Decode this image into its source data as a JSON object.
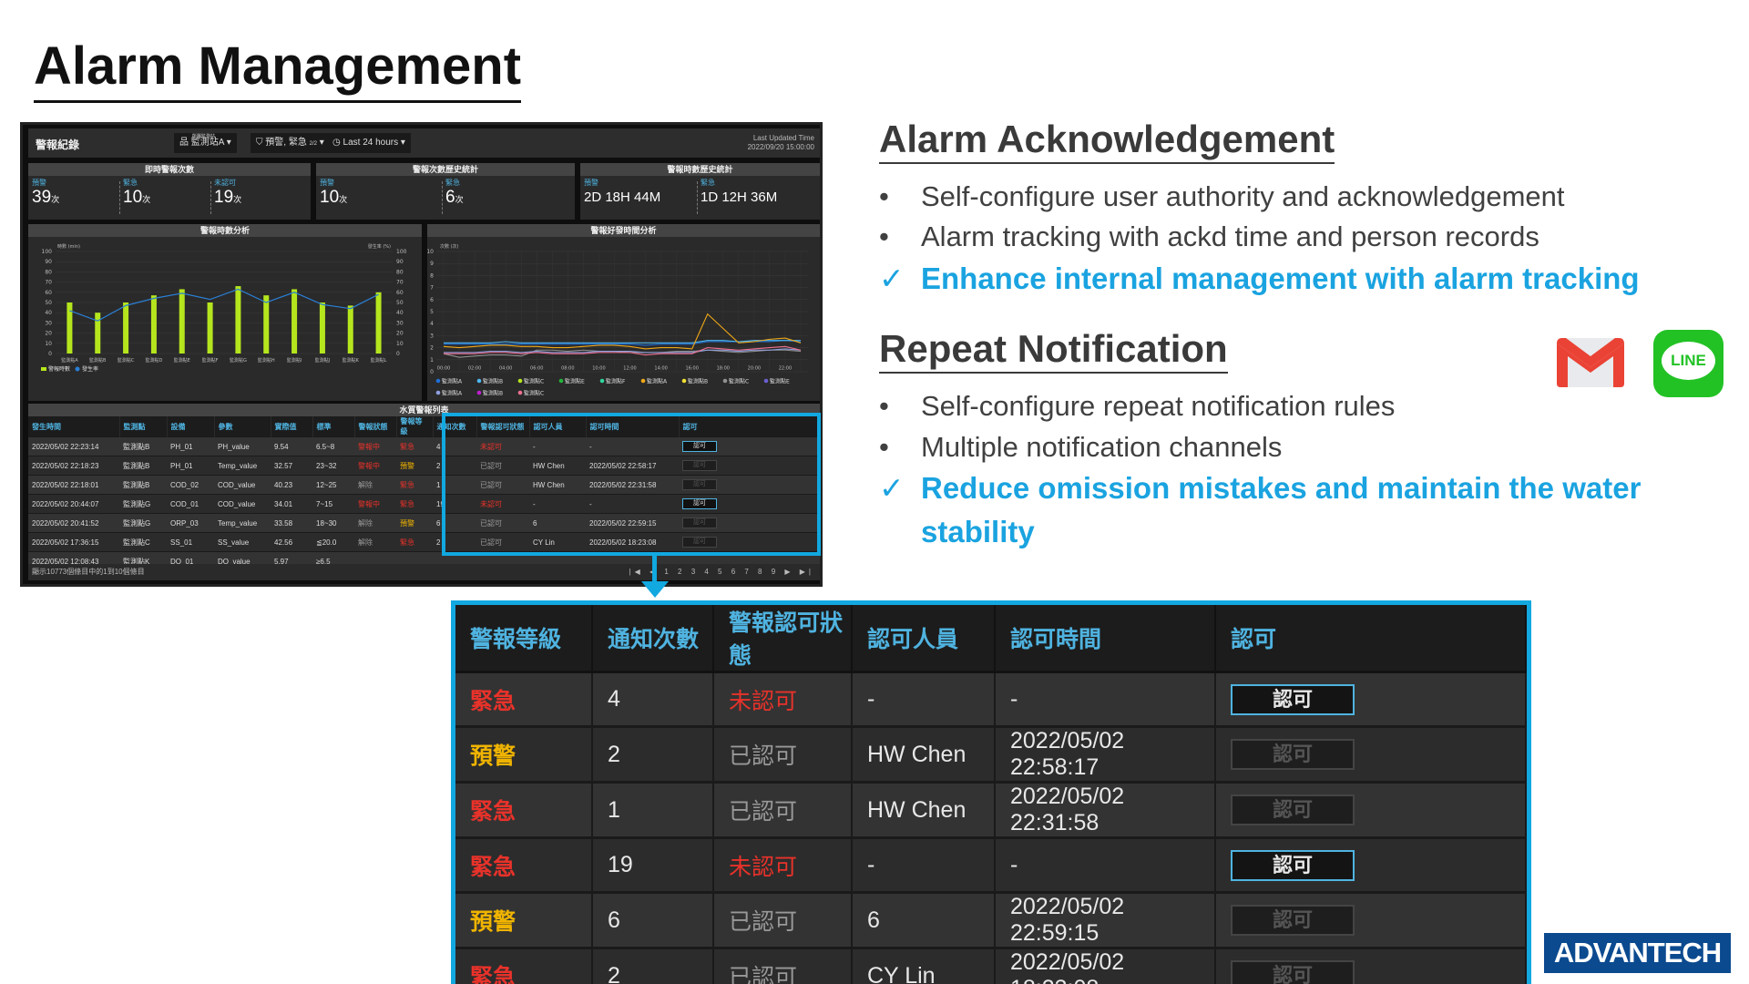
{
  "title": "Alarm Management",
  "dashboard": {
    "header": {
      "title": "警報紀錄",
      "site_label": "所屬監測站",
      "site": "監測站A",
      "filter": "預警, 緊急",
      "filter_count": "2/2",
      "time_range": "Last 24 hours",
      "updated_label": "Last Updated Time",
      "updated": "2022/09/20 15:00:00"
    },
    "realtime": {
      "title": "即時警報次數",
      "items": [
        {
          "label": "預警",
          "value": "39",
          "unit": "次"
        },
        {
          "label": "緊急",
          "value": "10",
          "unit": "次"
        },
        {
          "label": "未認可",
          "value": "19",
          "unit": "次"
        }
      ]
    },
    "count_history": {
      "title": "警報次數歷史統計",
      "items": [
        {
          "label": "預警",
          "value": "10",
          "unit": "次"
        },
        {
          "label": "緊急",
          "value": "6",
          "unit": "次"
        }
      ]
    },
    "duration_history": {
      "title": "警報時數歷史統計",
      "items": [
        {
          "label": "預警",
          "value": "2D 18H 44M"
        },
        {
          "label": "緊急",
          "value": "1D 12H 36M"
        }
      ]
    },
    "table": {
      "title": "水質警報列表",
      "columns": [
        "發生時間",
        "監測點",
        "設備",
        "參數",
        "實際值",
        "標準",
        "警報狀態",
        "警報等級",
        "通知次數",
        "警報認可狀態",
        "認可人員",
        "認可時間",
        "認可"
      ],
      "rows": [
        [
          "2022/05/02 22:23:14",
          "監測點B",
          "PH_01",
          "PH_value",
          "9.54",
          "6.5~8",
          "警報中",
          "緊急",
          "4",
          "未認可",
          "-",
          "-",
          "認可"
        ],
        [
          "2022/05/02 22:18:23",
          "監測點B",
          "PH_01",
          "Temp_value",
          "32.57",
          "23~32",
          "警報中",
          "預警",
          "2",
          "已認可",
          "HW Chen",
          "2022/05/02 22:58:17",
          "認可"
        ],
        [
          "2022/05/02 22:18:01",
          "監測點B",
          "COD_02",
          "COD_value",
          "40.23",
          "12~25",
          "解除",
          "緊急",
          "1",
          "已認可",
          "HW Chen",
          "2022/05/02 22:31:58",
          "認可"
        ],
        [
          "2022/05/02 20:44:07",
          "監測點G",
          "COD_01",
          "COD_value",
          "34.01",
          "7~15",
          "警報中",
          "緊急",
          "19",
          "未認可",
          "-",
          "-",
          "認可"
        ],
        [
          "2022/05/02 20:41:52",
          "監測點G",
          "ORP_03",
          "Temp_value",
          "33.58",
          "18~30",
          "解除",
          "預警",
          "6",
          "已認可",
          "6",
          "2022/05/02 22:59:15",
          "認可"
        ],
        [
          "2022/05/02 17:36:15",
          "監測點C",
          "SS_01",
          "SS_value",
          "42.56",
          "≦20.0",
          "解除",
          "緊急",
          "2",
          "已認可",
          "CY Lin",
          "2022/05/02 18:23:08",
          "認可"
        ],
        [
          "2022/05/02 12:08:43",
          "監測點K",
          "DO_01",
          "DO_value",
          "5.97",
          "≥6.5",
          "",
          "",
          "",
          "",
          "",
          "",
          ""
        ]
      ],
      "footer": "顯示10773個條目中的1到10個條目",
      "pager": "|◀ ◀ 1 2 3 4 5 6 7 8 9 ▶ ▶|"
    }
  },
  "chart_data": [
    {
      "type": "bar",
      "title": "警報時數分析",
      "ylabel": "時數 (min)",
      "y2label": "發生率 (%)",
      "ylim": [
        0,
        100
      ],
      "y2lim": [
        0,
        100
      ],
      "grid": true,
      "legend": "bottom-left",
      "categories": [
        "監測點A",
        "監測點B",
        "監測點C",
        "監測點D",
        "監測點E",
        "監測點F",
        "監測點G",
        "監測點H",
        "監測點I",
        "監測點J",
        "監測點K",
        "監測點L"
      ],
      "series": [
        {
          "name": "警報時數",
          "type": "bar",
          "color": "#b5e61d",
          "values": [
            50,
            40,
            50,
            57,
            63,
            50,
            66,
            57,
            63,
            50,
            47,
            60
          ]
        },
        {
          "name": "發生率",
          "type": "line",
          "color": "#2a7fd4",
          "values": [
            42,
            32,
            47,
            54,
            59,
            53,
            63,
            50,
            60,
            48,
            44,
            58
          ]
        }
      ]
    },
    {
      "type": "line",
      "title": "警報好發時間分析",
      "ylabel": "次數 (次)",
      "ylim": [
        0,
        10
      ],
      "grid": true,
      "legend": "bottom",
      "x": [
        "00:00",
        "01:00",
        "02:00",
        "03:00",
        "04:00",
        "05:00",
        "06:00",
        "07:00",
        "08:00",
        "09:00",
        "10:00",
        "11:00",
        "12:00",
        "13:00",
        "14:00",
        "15:00",
        "16:00",
        "17:00",
        "18:00",
        "19:00",
        "20:00",
        "21:00",
        "22:00",
        "23:00"
      ],
      "xticks": [
        "00:00",
        "02:00",
        "04:00",
        "06:00",
        "08:00",
        "10:00",
        "12:00",
        "14:00",
        "16:00",
        "18:00",
        "20:00",
        "22:00"
      ],
      "series": [
        {
          "name": "監測點A",
          "color": "#1f6fd6",
          "values": [
            2.3,
            2.3,
            2.3,
            2.3,
            2.3,
            2.3,
            2.3,
            2.3,
            2.3,
            2.3,
            2.3,
            2.3,
            2.3,
            2.2,
            2.3,
            2.3,
            2.3,
            2.5,
            2.5,
            2.5,
            2.5,
            2.5,
            2.6,
            2.5
          ]
        },
        {
          "name": "監測點B",
          "color": "#4fb8f0",
          "values": [
            2.4,
            2.4,
            2.4,
            2.4,
            2.5,
            2.4,
            2.4,
            2.4,
            2.4,
            2.4,
            2.4,
            2.4,
            2.4,
            2.4,
            2.4,
            2.4,
            2.4,
            2.6,
            2.6,
            2.5,
            2.6,
            2.6,
            2.6,
            2.6
          ]
        },
        {
          "name": "監測點C",
          "color": "#b5e61d",
          "values": []
        },
        {
          "name": "監測點E",
          "color": "#22b43a",
          "values": []
        },
        {
          "name": "監測點F",
          "color": "#2ed6a0",
          "values": []
        },
        {
          "name": "監測點A",
          "color": "#f0a818",
          "values": [
            2.1,
            2.0,
            2.1,
            2.2,
            2.2,
            2.1,
            2.1,
            2.0,
            2.0,
            2.1,
            2.2,
            2.2,
            2.1,
            1.9,
            2.0,
            2.0,
            1.9,
            4.8,
            3.6,
            2.4,
            2.5,
            2.7,
            2.8,
            2.4
          ]
        },
        {
          "name": "監測點B",
          "color": "#f0e030",
          "values": []
        },
        {
          "name": "監測點C",
          "color": "#909090",
          "values": [
            1.5,
            1.2,
            1.3,
            1.4,
            1.4,
            1.3,
            1.8,
            1.8,
            1.7,
            1.8,
            1.7,
            1.7,
            1.6,
            1.6,
            1.6,
            1.7,
            1.7,
            1.8,
            1.7,
            1.6,
            1.7,
            1.8,
            1.8,
            1.7
          ]
        },
        {
          "name": "監測點E",
          "color": "#6a5fd0",
          "values": []
        },
        {
          "name": "監測點A",
          "color": "#8fa0e0",
          "values": [
            1.6,
            1.6,
            1.6,
            1.7,
            1.7,
            1.6,
            1.7,
            1.6,
            1.6,
            1.6,
            1.7,
            1.7,
            1.7,
            1.6,
            1.6,
            1.6,
            1.6,
            1.8,
            1.8,
            1.7,
            1.8,
            1.8,
            1.9,
            1.8
          ]
        },
        {
          "name": "監測點B",
          "color": "#c020d0",
          "values": []
        },
        {
          "name": "監測點C",
          "color": "#f07090",
          "values": [
            1.5,
            1.5,
            1.5,
            1.6,
            1.6,
            1.5,
            1.6,
            1.5,
            1.5,
            1.5,
            1.6,
            1.6,
            1.6,
            1.4,
            1.5,
            1.5,
            1.5,
            2.0,
            1.9,
            1.8,
            1.9,
            2.0,
            2.1,
            1.8
          ]
        }
      ]
    }
  ],
  "ack": {
    "heading": "Alarm Acknowledgement",
    "bullets": [
      "Self-configure user authority and acknowledgement",
      "Alarm tracking with ackd time and person records"
    ],
    "highlight": "Enhance internal management with alarm tracking",
    "bullet_mark": "•",
    "check_mark": "✓"
  },
  "repeat": {
    "heading": "Repeat Notification",
    "bullets": [
      "Self-configure repeat notification rules",
      "Multiple notification channels"
    ],
    "highlight_1": "Reduce omission mistakes and maintain the water",
    "highlight_2": "stability"
  },
  "channels": {
    "gmail": "Gmail",
    "line": "LINE"
  },
  "zoom_table": {
    "columns": [
      "警報等級",
      "通知次數",
      "警報認可狀態",
      "認可人員",
      "認可時間",
      "認可"
    ],
    "rows": [
      {
        "level": "緊急",
        "count": "4",
        "status": "未認可",
        "person": "-",
        "time": "-",
        "button": "認可",
        "active": true
      },
      {
        "level": "預警",
        "count": "2",
        "status": "已認可",
        "person": "HW Chen",
        "time": "2022/05/02 22:58:17",
        "button": "認可",
        "active": false
      },
      {
        "level": "緊急",
        "count": "1",
        "status": "已認可",
        "person": "HW Chen",
        "time": "2022/05/02 22:31:58",
        "button": "認可",
        "active": false
      },
      {
        "level": "緊急",
        "count": "19",
        "status": "未認可",
        "person": "-",
        "time": "-",
        "button": "認可",
        "active": true
      },
      {
        "level": "預警",
        "count": "6",
        "status": "已認可",
        "person": "6",
        "time": "2022/05/02 22:59:15",
        "button": "認可",
        "active": false
      },
      {
        "level": "緊急",
        "count": "2",
        "status": "已認可",
        "person": "CY Lin",
        "time": "2022/05/02 18:23:08",
        "button": "認可",
        "active": false
      }
    ]
  },
  "brand": "ADVANTECH",
  "colors": {
    "accent": "#1aa3e0",
    "highlight_border": "#12a8e0",
    "urgent": "#e8322a",
    "warning": "#f0b400",
    "header_text": "#4fb3e0"
  }
}
